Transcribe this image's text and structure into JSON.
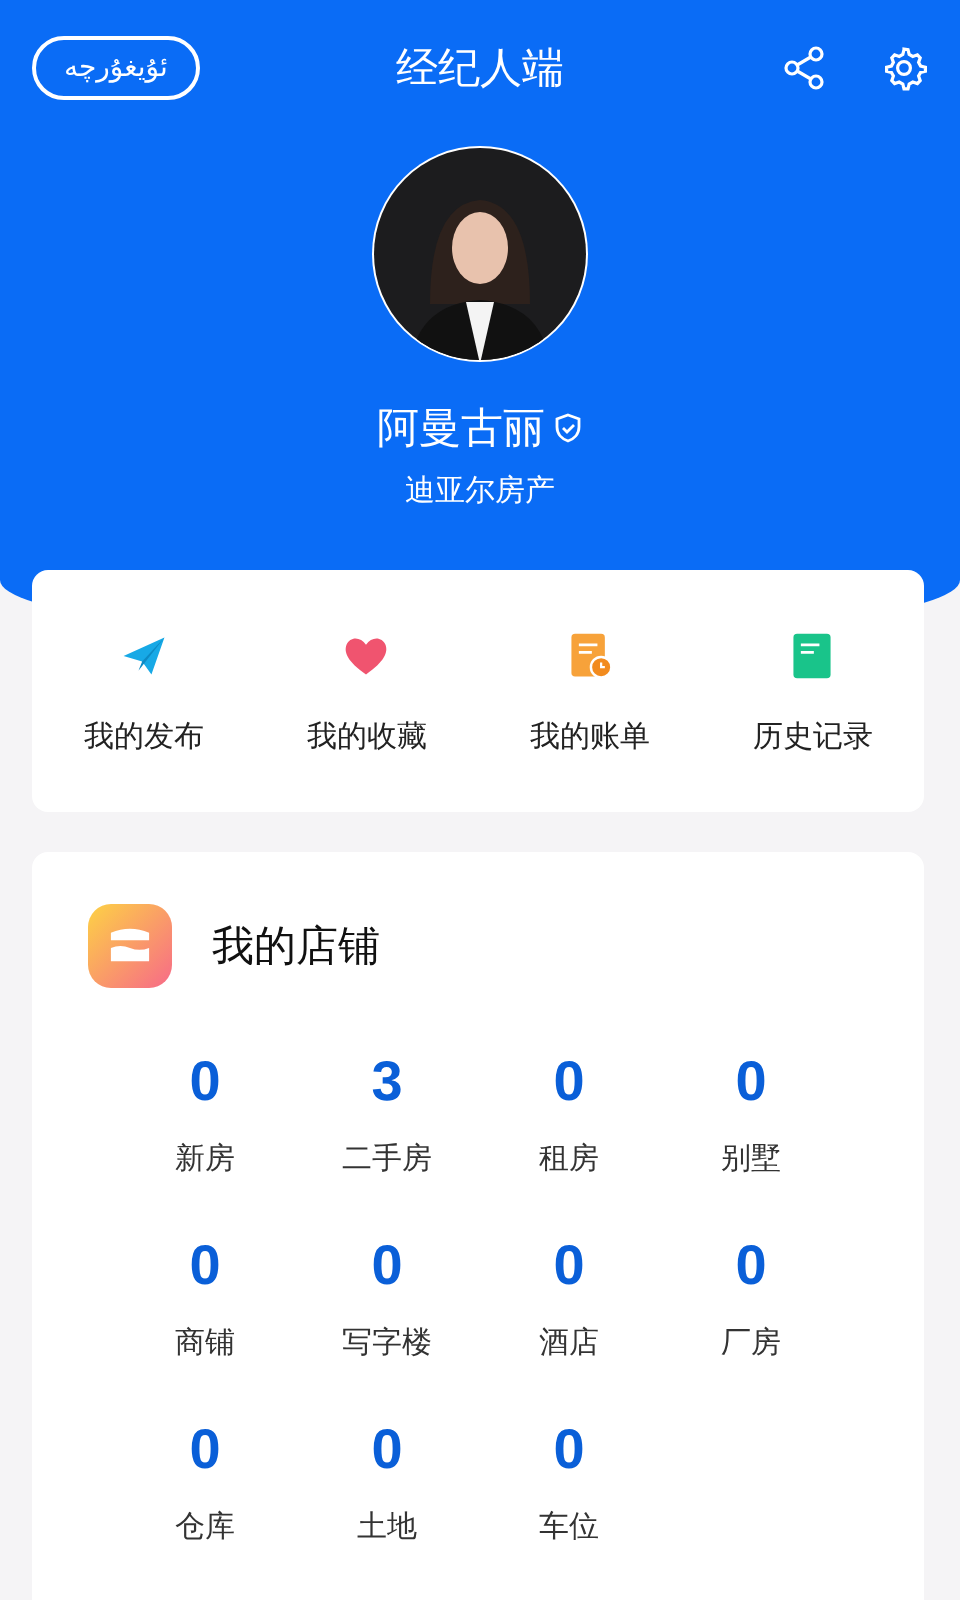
{
  "header": {
    "language_button": "ئۇيغۇرچە",
    "title": "经纪人端"
  },
  "profile": {
    "name": "阿曼古丽",
    "verified": true,
    "company": "迪亚尔房产"
  },
  "shortcuts": [
    {
      "kind": "send",
      "label": "我的发布"
    },
    {
      "kind": "heart",
      "label": "我的收藏"
    },
    {
      "kind": "bill",
      "label": "我的账单"
    },
    {
      "kind": "history",
      "label": "历史记录"
    }
  ],
  "store": {
    "title": "我的店铺",
    "stats": [
      {
        "count": "0",
        "label": "新房"
      },
      {
        "count": "3",
        "label": "二手房"
      },
      {
        "count": "0",
        "label": "租房"
      },
      {
        "count": "0",
        "label": "别墅"
      },
      {
        "count": "0",
        "label": "商铺"
      },
      {
        "count": "0",
        "label": "写字楼"
      },
      {
        "count": "0",
        "label": "酒店"
      },
      {
        "count": "0",
        "label": "厂房"
      },
      {
        "count": "0",
        "label": "仓库"
      },
      {
        "count": "0",
        "label": "土地"
      },
      {
        "count": "0",
        "label": "车位"
      }
    ]
  }
}
